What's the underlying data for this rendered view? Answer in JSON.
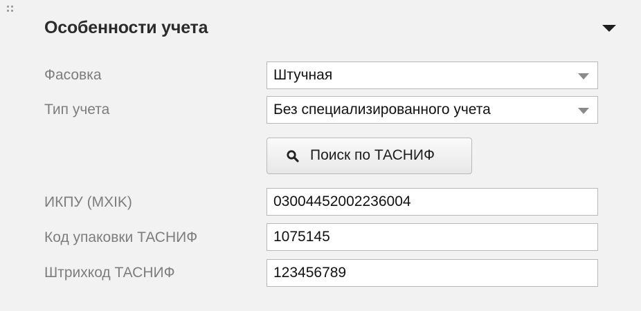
{
  "panel": {
    "title": "Особенности учета"
  },
  "fields": {
    "packaging": {
      "label": "Фасовка",
      "value": "Штучная"
    },
    "accounting_type": {
      "label": "Тип учета",
      "value": "Без специализированного учета"
    },
    "ikpu": {
      "label": "ИКПУ (MXIK)",
      "value": "03004452002236004"
    },
    "package_code": {
      "label": "Код упаковки ТАСНИФ",
      "value": "1075145"
    },
    "barcode": {
      "label": "Штрихкод ТАСНИФ",
      "value": "123456789"
    }
  },
  "search_button": {
    "label": "Поиск по ТАСНИФ"
  },
  "icons": {
    "drag_handle": "drag-handle-icon",
    "collapse": "triangle-down-icon",
    "dropdown": "caret-down-icon",
    "search": "magnifier-icon"
  },
  "colors": {
    "background": "#f2f2f2",
    "label": "#7d7d7d",
    "title": "#2b2b2b",
    "field_border": "#b8b8b8"
  }
}
